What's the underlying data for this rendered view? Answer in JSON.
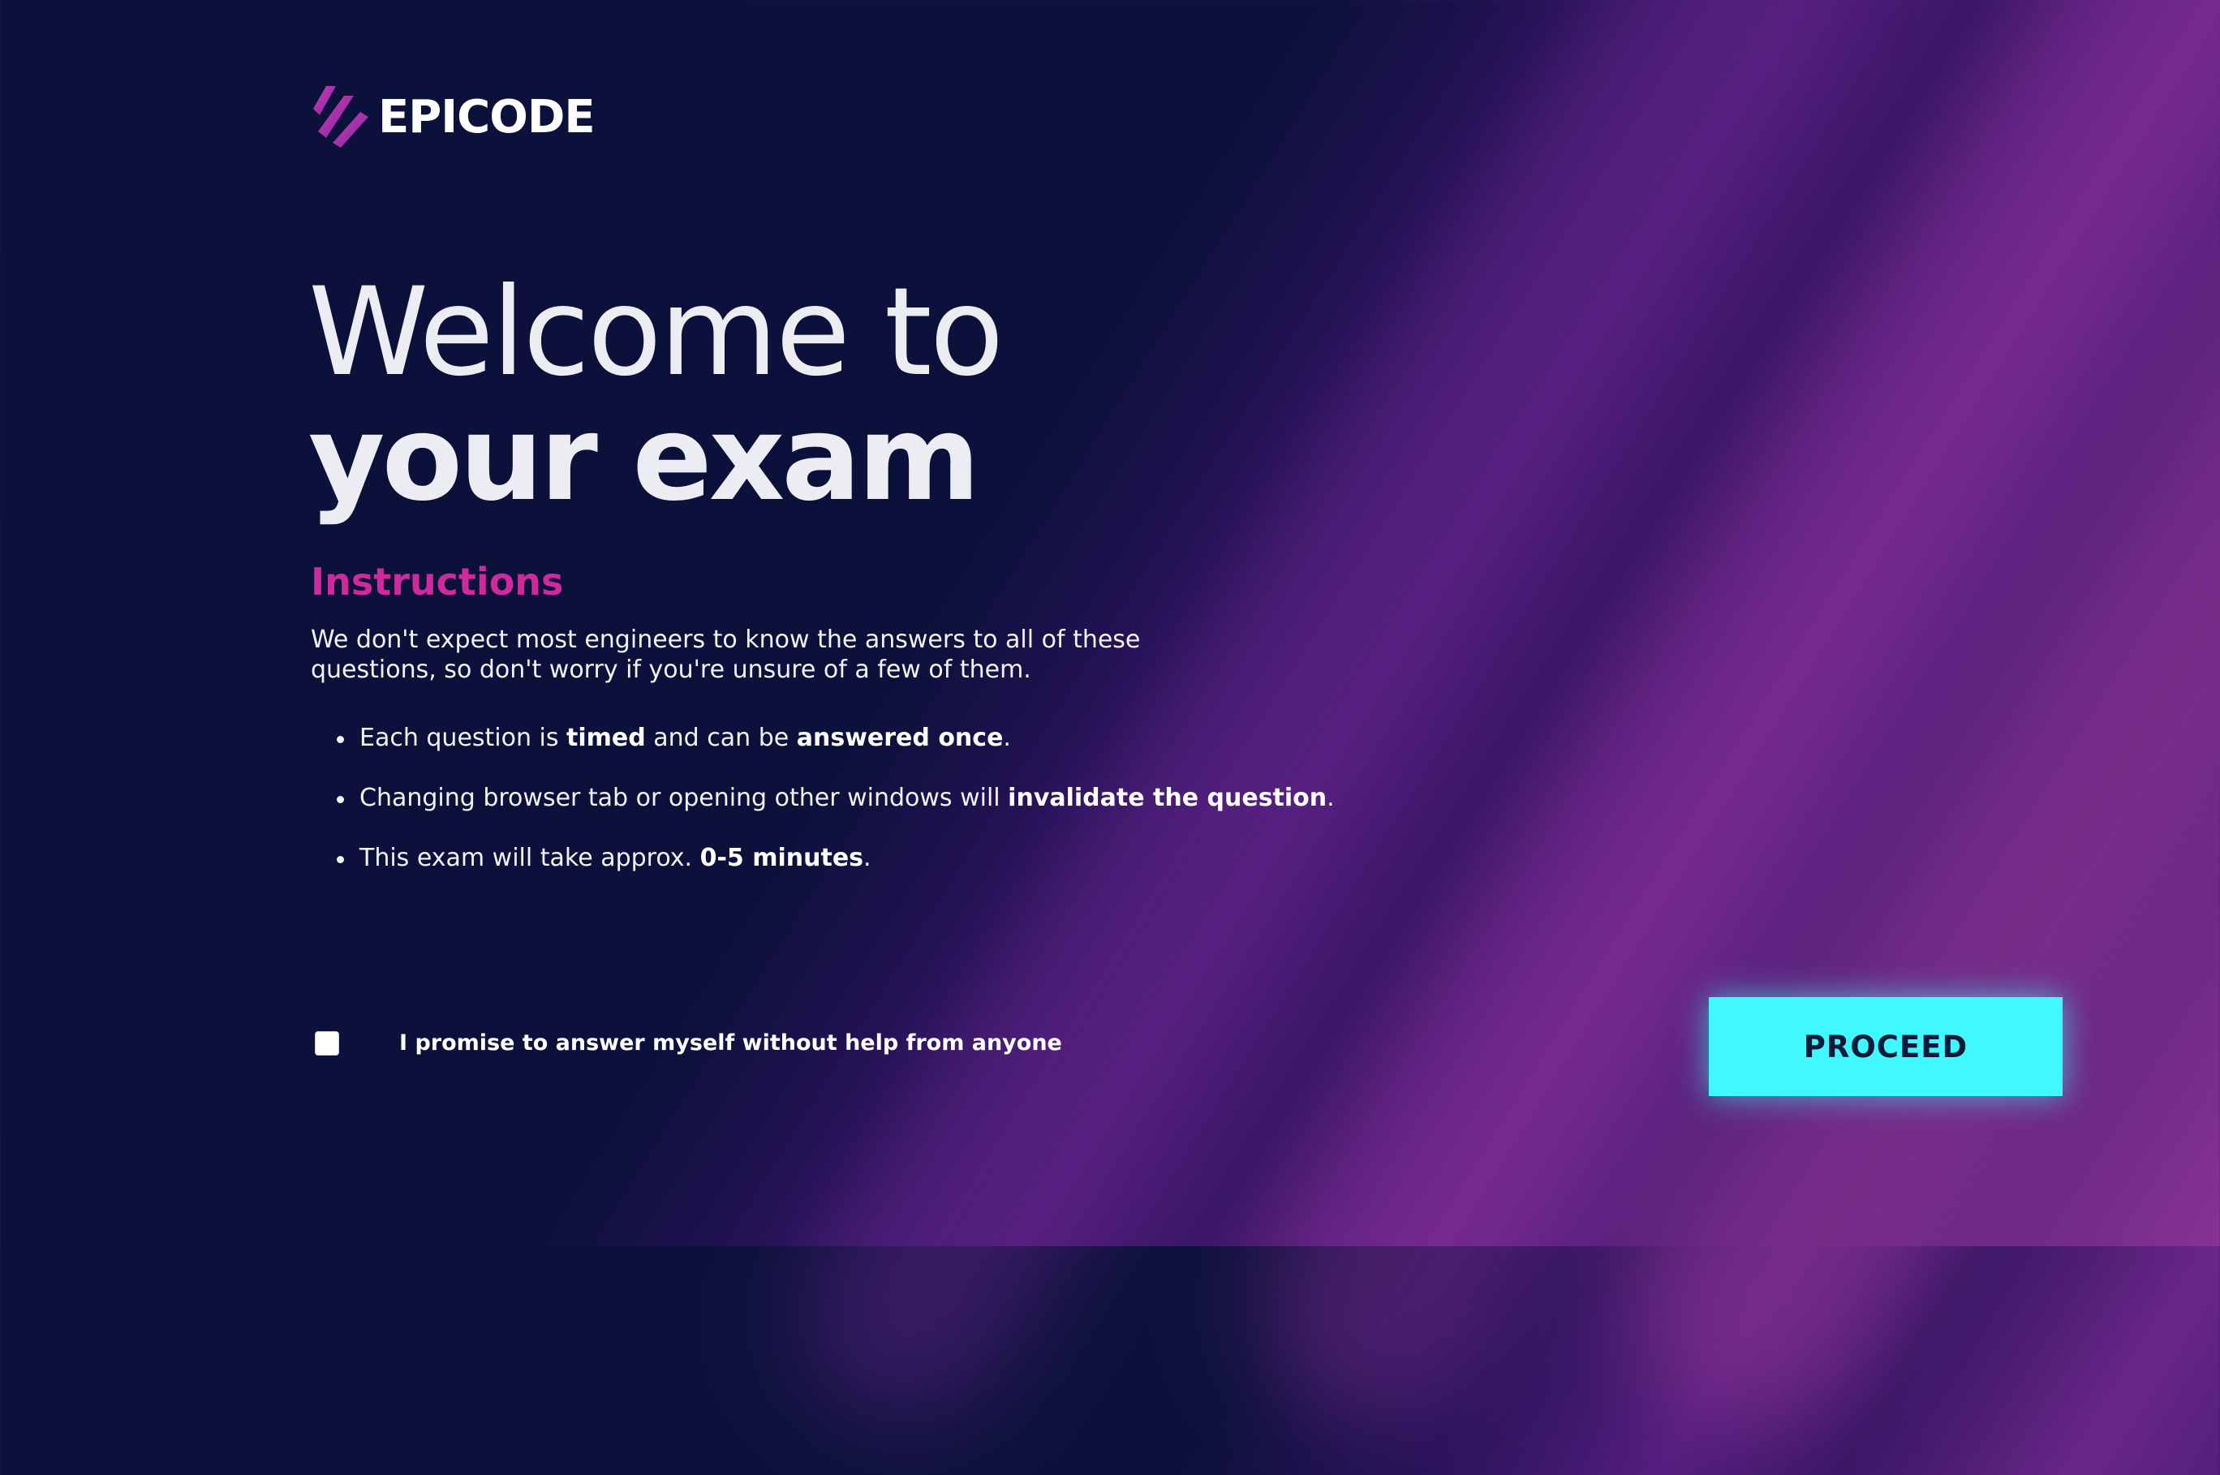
{
  "brand": {
    "name": "EPICODE",
    "logo_icon": "epicode-stripes-logo",
    "colors": {
      "background": "#0c113b",
      "accent_pink": "#cf2a9d",
      "button_cyan": "#40f8ff",
      "button_text": "#121a3a"
    }
  },
  "hero": {
    "title_light": "Welcome to",
    "title_bold": "your exam"
  },
  "instructions": {
    "title": "Instructions",
    "intro": "We don't expect most engineers to know the answers to all of these questions, so don't worry if you're unsure of a few of them.",
    "rules": [
      {
        "p1": "Each question is ",
        "b1": "timed",
        "p2": " and can be ",
        "b2": "answered once",
        "p3": "."
      },
      {
        "p1": "Changing browser tab or opening other windows will ",
        "b1": "invalidate the question",
        "p2": "."
      },
      {
        "p1": "This exam will take approx. ",
        "b1": "0-5 minutes",
        "p2": "."
      }
    ]
  },
  "agreement": {
    "checked": false,
    "label": "I promise to answer myself without help from anyone"
  },
  "actions": {
    "proceed_label": "PROCEED"
  }
}
